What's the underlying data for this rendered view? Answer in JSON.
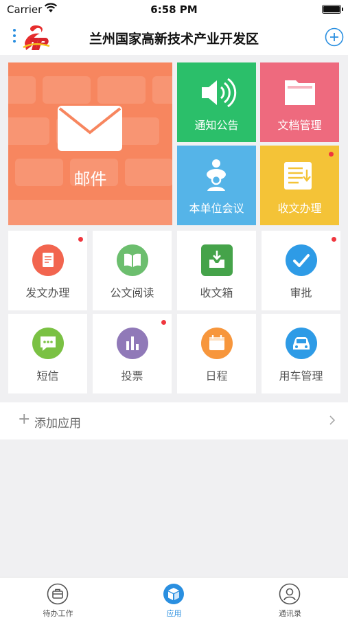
{
  "status_bar": {
    "carrier": "Carrier",
    "time": "6:58 PM"
  },
  "nav": {
    "title": "兰州国家高新技术产业开发区"
  },
  "tiles": {
    "mail": "邮件",
    "notice": "通知公告",
    "docs": "文档管理",
    "meeting": "本单位会议",
    "receive": "收文办理"
  },
  "apps": [
    {
      "label": "发文办理",
      "color": "#f2654f",
      "icon": "document-edit-icon",
      "badge": true
    },
    {
      "label": "公文阅读",
      "color": "#6cbe6e",
      "icon": "open-book-icon",
      "badge": false
    },
    {
      "label": "收文箱",
      "color": "#45a34a",
      "icon": "inbox-download-icon",
      "badge": false
    },
    {
      "label": "审批",
      "color": "#2e9be6",
      "icon": "checkmark-icon",
      "badge": true
    },
    {
      "label": "短信",
      "color": "#7ac143",
      "icon": "chat-bubble-icon",
      "badge": false
    },
    {
      "label": "投票",
      "color": "#9079b8",
      "icon": "bar-chart-icon",
      "badge": true
    },
    {
      "label": "日程",
      "color": "#f7963c",
      "icon": "calendar-icon",
      "badge": false
    },
    {
      "label": "用车管理",
      "color": "#2e9be6",
      "icon": "car-icon",
      "badge": false
    }
  ],
  "add_app": {
    "label": "添加应用"
  },
  "tabs": [
    {
      "label": "待办工作",
      "icon": "briefcase-icon"
    },
    {
      "label": "应用",
      "icon": "cube-icon",
      "active": true
    },
    {
      "label": "通讯录",
      "icon": "contacts-icon"
    }
  ],
  "colors": {
    "mail": "#f7865f",
    "notice": "#2bbf6a",
    "docs": "#ee6a7e",
    "meeting": "#55b4e8",
    "receive": "#f4c337",
    "accent": "#2a8fe0",
    "badge": "#f0363e"
  }
}
